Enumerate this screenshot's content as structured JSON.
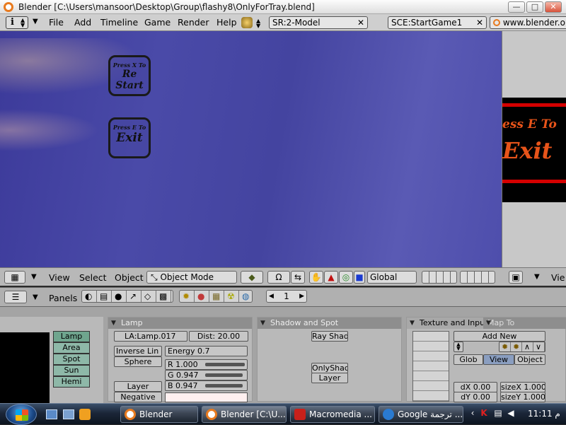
{
  "window": {
    "title": "Blender [C:\\Users\\mansoor\\Desktop\\Group\\flashy8\\OnlyForTray.blend]",
    "minimize": "—",
    "maximize": "□",
    "close": "✕"
  },
  "menubar": {
    "info_icon": "i",
    "items": [
      "File",
      "Add",
      "Timeline",
      "Game",
      "Render",
      "Help"
    ],
    "screen": "SR:2-Model",
    "scene": "SCE:StartGame1",
    "url": "www.blender.or"
  },
  "viewport": {
    "buttons": [
      {
        "small": "Press X To",
        "big": "Re Start"
      },
      {
        "small": "Press E To",
        "big": "Exit"
      }
    ]
  },
  "right_preview": {
    "line1": "ess E To",
    "line2": "Exit"
  },
  "view_header": {
    "view": "View",
    "select": "Select",
    "object": "Object",
    "mode": "Object Mode",
    "orientation": "Global",
    "right_view": "Vie"
  },
  "buttons_header": {
    "panels": "Panels",
    "frame": "1"
  },
  "lamp_types": [
    "Lamp",
    "Area",
    "Spot",
    "Sun",
    "Hemi"
  ],
  "lamp_panel": {
    "title": "Lamp",
    "name": "LA:Lamp.017",
    "dist": "Dist: 20.00",
    "falloff": "Inverse Lin",
    "shape": "Sphere",
    "energy": "Energy 0.7",
    "r": "R 1.000",
    "g": "G 0.947",
    "b": "B 0.947",
    "layer": "Layer",
    "negative": "Negative"
  },
  "shadow_panel": {
    "title": "Shadow and Spot",
    "ray_shad": "Ray Shad",
    "only_shad": "OnlyShad",
    "layer": "Layer"
  },
  "texture_panel": {
    "title": "Texture and Inpu",
    "tab2": "Map To",
    "add_new": "Add New",
    "glob": "Glob",
    "view": "View",
    "object": "Object",
    "dx": "dX 0.00",
    "dy": "dY 0.00",
    "sizex": "sizeX 1.000",
    "sizey": "sizeY 1.000"
  },
  "taskbar": {
    "items": [
      "Blender",
      "Blender [C:\\U...",
      "Macromedia ...",
      "Google ترجمة ..."
    ],
    "clock": "11:11 م"
  },
  "colors": {
    "viewport": "#4646a6",
    "exit_text": "#e8541a",
    "red_line": "#d40000",
    "taskbar": "#1b2638"
  }
}
